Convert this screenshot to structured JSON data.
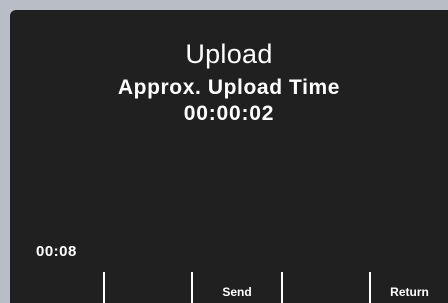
{
  "screen": {
    "title": "Upload",
    "subtitle": "Approx. Upload Time",
    "upload_time": "00:00:02",
    "clock": "00:08"
  },
  "softkeys": [
    {
      "label": ""
    },
    {
      "label": ""
    },
    {
      "label": "Send"
    },
    {
      "label": ""
    },
    {
      "label": "Return"
    }
  ]
}
